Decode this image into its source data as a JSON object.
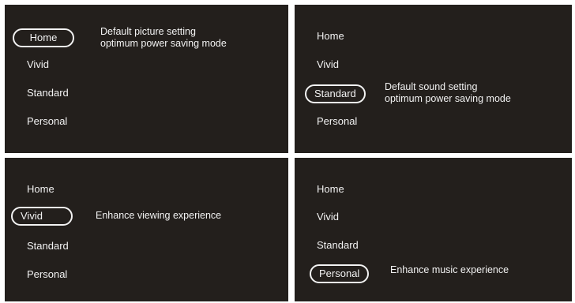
{
  "panels": [
    {
      "items": [
        "Home",
        "Vivid",
        "Standard",
        "Personal"
      ],
      "selected": "Home",
      "description": [
        "Default  picture setting",
        "optimum  power saving mode"
      ]
    },
    {
      "items": [
        "Home",
        "Vivid",
        "Standard",
        "Personal"
      ],
      "selected": "Standard",
      "description": [
        "Default  sound setting",
        "optimum  power saving mode"
      ]
    },
    {
      "items": [
        "Home",
        "Vivid",
        "Standard",
        "Personal"
      ],
      "selected": "Vivid",
      "description": [
        "Enhance viewing experience"
      ]
    },
    {
      "items": [
        "Home",
        "Vivid",
        "Standard",
        "Personal"
      ],
      "selected": "Personal",
      "description": [
        "Enhance music experience"
      ]
    }
  ],
  "colors": {
    "panel_background": "#231f1c",
    "text": "#f2f2f2",
    "page_background": "#ffffff"
  }
}
